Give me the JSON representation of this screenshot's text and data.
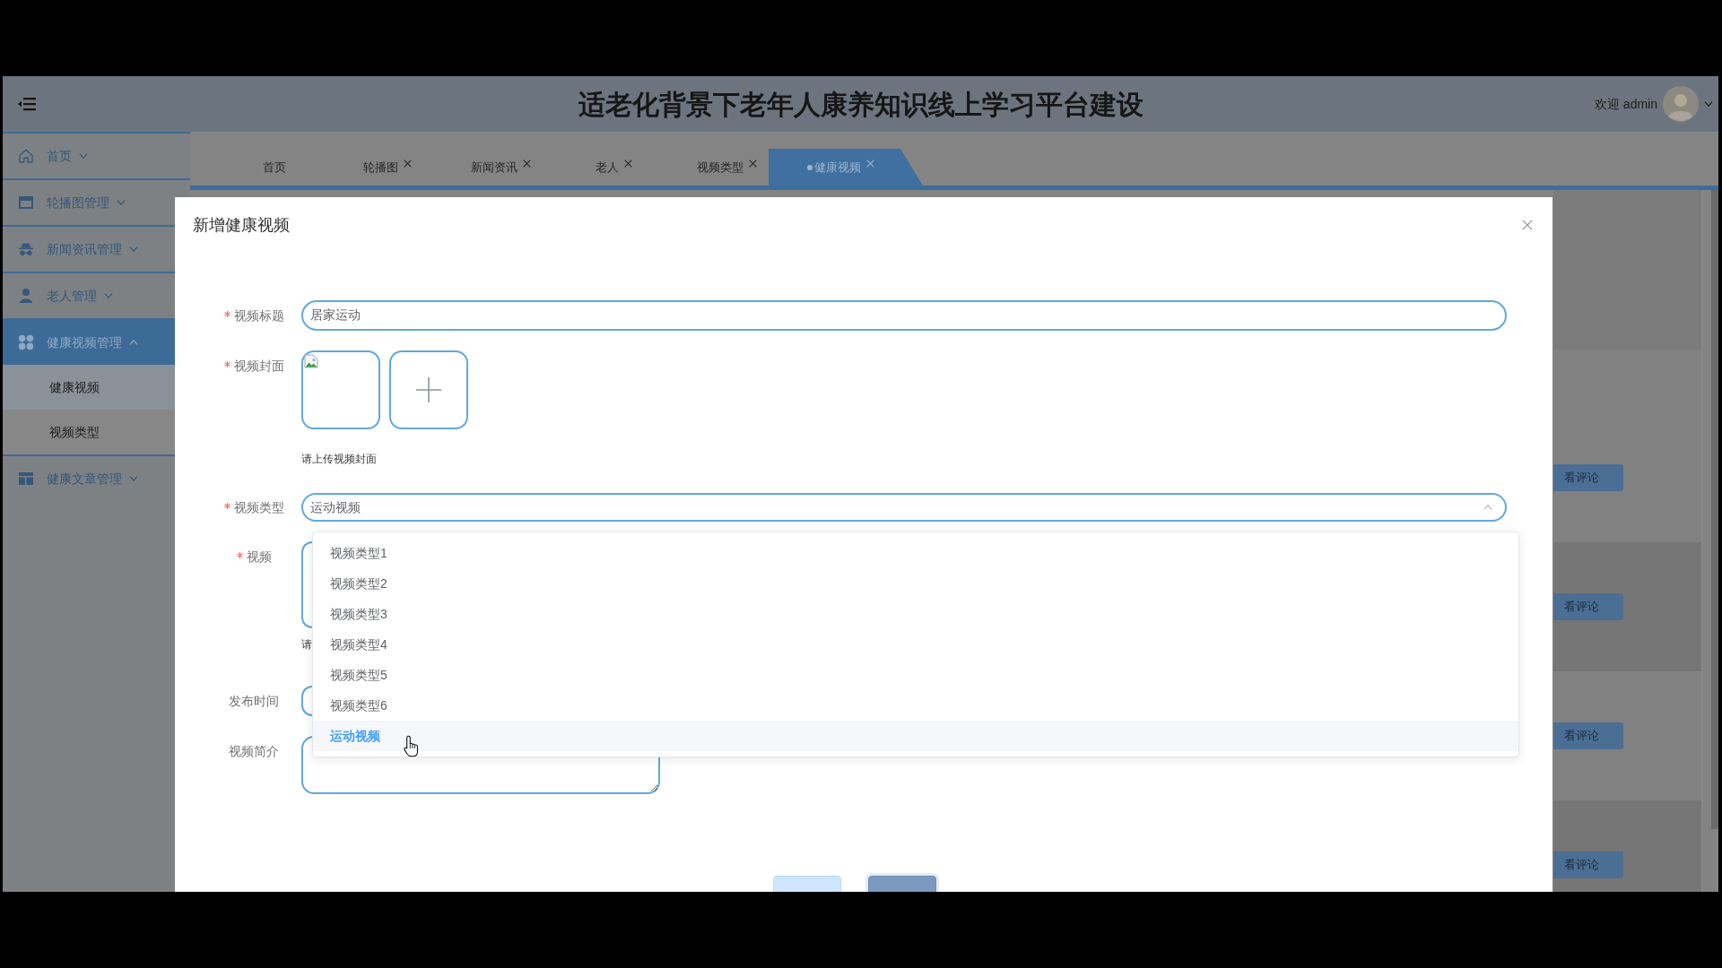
{
  "header": {
    "title": "适老化背景下老年人康养知识线上学习平台建设",
    "welcome": "欢迎 admin"
  },
  "sidebar": {
    "items": [
      {
        "label": "首页",
        "selected": false,
        "expanded": false
      },
      {
        "label": "轮播图管理",
        "selected": false,
        "expanded": false
      },
      {
        "label": "新闻资讯管理",
        "selected": false,
        "expanded": false
      },
      {
        "label": "老人管理",
        "selected": false,
        "expanded": false
      },
      {
        "label": "健康视频管理",
        "selected": true,
        "expanded": true,
        "children": [
          {
            "label": "健康视频",
            "selected": true
          },
          {
            "label": "视频类型",
            "selected": false
          }
        ]
      },
      {
        "label": "健康文章管理",
        "selected": false,
        "expanded": false
      }
    ]
  },
  "tabs": [
    {
      "label": "首页",
      "closable": false,
      "selected": false
    },
    {
      "label": "轮播图",
      "closable": true,
      "selected": false
    },
    {
      "label": "新闻资讯",
      "closable": true,
      "selected": false
    },
    {
      "label": "老人",
      "closable": true,
      "selected": false
    },
    {
      "label": "视频类型",
      "closable": true,
      "selected": false
    },
    {
      "label": "健康视频",
      "closable": true,
      "selected": true
    }
  ],
  "table": {
    "rows": [
      {
        "action": "看评论"
      },
      {
        "action": "看评论"
      },
      {
        "action": "看评论"
      },
      {
        "action": "看评论"
      }
    ]
  },
  "dialog": {
    "title": "新增健康视频",
    "fields": [
      {
        "kind": "text",
        "label": "视频标题",
        "required": true,
        "value": "居家运动"
      },
      {
        "kind": "image-upload",
        "label": "视频封面",
        "required": true,
        "items": [
          {
            "kind": "image"
          },
          {
            "kind": "add"
          }
        ],
        "hint": "请上传视频封面"
      },
      {
        "kind": "select",
        "label": "视频类型",
        "required": true,
        "value": "运动视频",
        "expanded": true,
        "options": [
          {
            "label": "视频类型1",
            "selected": false,
            "hovered": false
          },
          {
            "label": "视频类型2",
            "selected": false,
            "hovered": false
          },
          {
            "label": "视频类型3",
            "selected": false,
            "hovered": false
          },
          {
            "label": "视频类型4",
            "selected": false,
            "hovered": false
          },
          {
            "label": "视频类型5",
            "selected": false,
            "hovered": false
          },
          {
            "label": "视频类型6",
            "selected": false,
            "hovered": false
          },
          {
            "label": "运动视频",
            "selected": true,
            "hovered": true
          }
        ]
      },
      {
        "kind": "file-upload",
        "label": "视频",
        "required": true,
        "hint": "请"
      },
      {
        "kind": "date",
        "label": "发布时间",
        "required": false
      },
      {
        "kind": "textarea",
        "label": "视频简介",
        "required": false
      }
    ],
    "buttons": [
      {
        "kind": "cancel"
      },
      {
        "kind": "submit"
      }
    ]
  }
}
